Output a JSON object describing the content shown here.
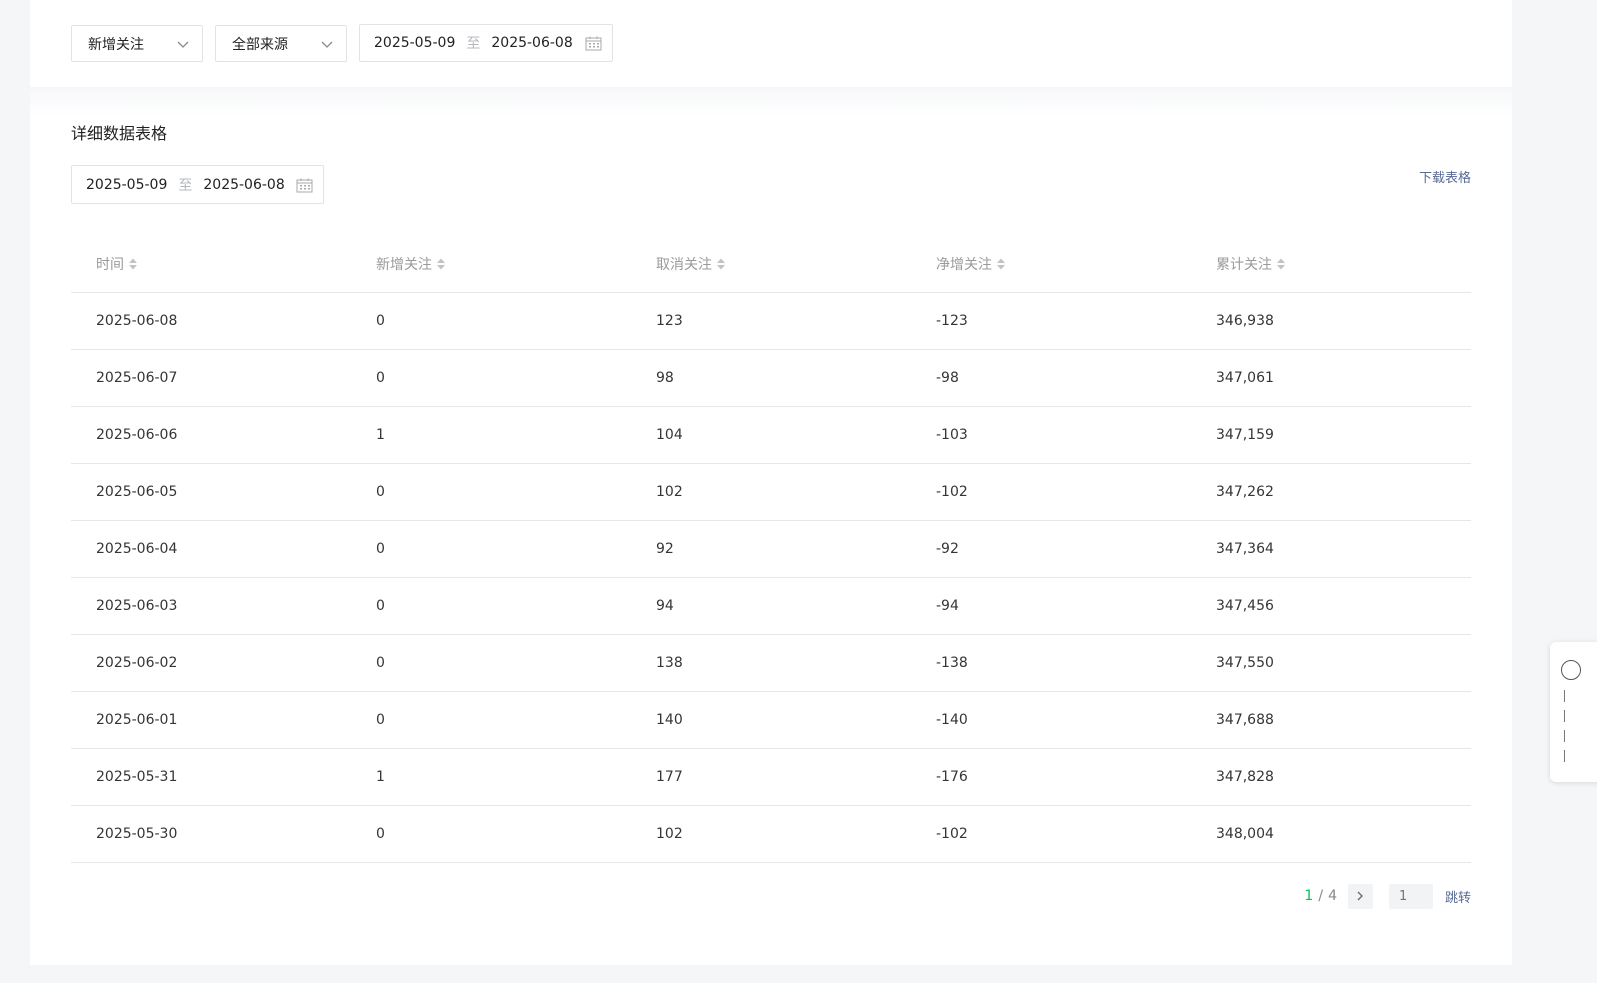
{
  "filters": {
    "metric_select": "新增关注",
    "source_select": "全部来源",
    "date_start": "2025-05-09",
    "date_sep": "至",
    "date_end": "2025-06-08"
  },
  "table_section": {
    "title": "详细数据表格",
    "download_label": "下载表格",
    "date_start": "2025-05-09",
    "date_sep": "至",
    "date_end": "2025-06-08",
    "columns": [
      "时间",
      "新增关注",
      "取消关注",
      "净增关注",
      "累计关注"
    ],
    "rows": [
      [
        "2025-06-08",
        "0",
        "123",
        "-123",
        "346,938"
      ],
      [
        "2025-06-07",
        "0",
        "98",
        "-98",
        "347,061"
      ],
      [
        "2025-06-06",
        "1",
        "104",
        "-103",
        "347,159"
      ],
      [
        "2025-06-05",
        "0",
        "102",
        "-102",
        "347,262"
      ],
      [
        "2025-06-04",
        "0",
        "92",
        "-92",
        "347,364"
      ],
      [
        "2025-06-03",
        "0",
        "94",
        "-94",
        "347,456"
      ],
      [
        "2025-06-02",
        "0",
        "138",
        "-138",
        "347,550"
      ],
      [
        "2025-06-01",
        "0",
        "140",
        "-140",
        "347,688"
      ],
      [
        "2025-05-31",
        "1",
        "177",
        "-176",
        "347,828"
      ],
      [
        "2025-05-30",
        "0",
        "102",
        "-102",
        "348,004"
      ]
    ]
  },
  "pagination": {
    "current": "1",
    "separator": "/",
    "total": "4",
    "jump_placeholder": "1",
    "jump_label": "跳转"
  },
  "colors": {
    "accent_green": "#07c160",
    "link_blue": "#576b95"
  },
  "icons": [
    "chevron-down-icon",
    "calendar-icon",
    "sort-icon",
    "chevron-right-icon"
  ]
}
